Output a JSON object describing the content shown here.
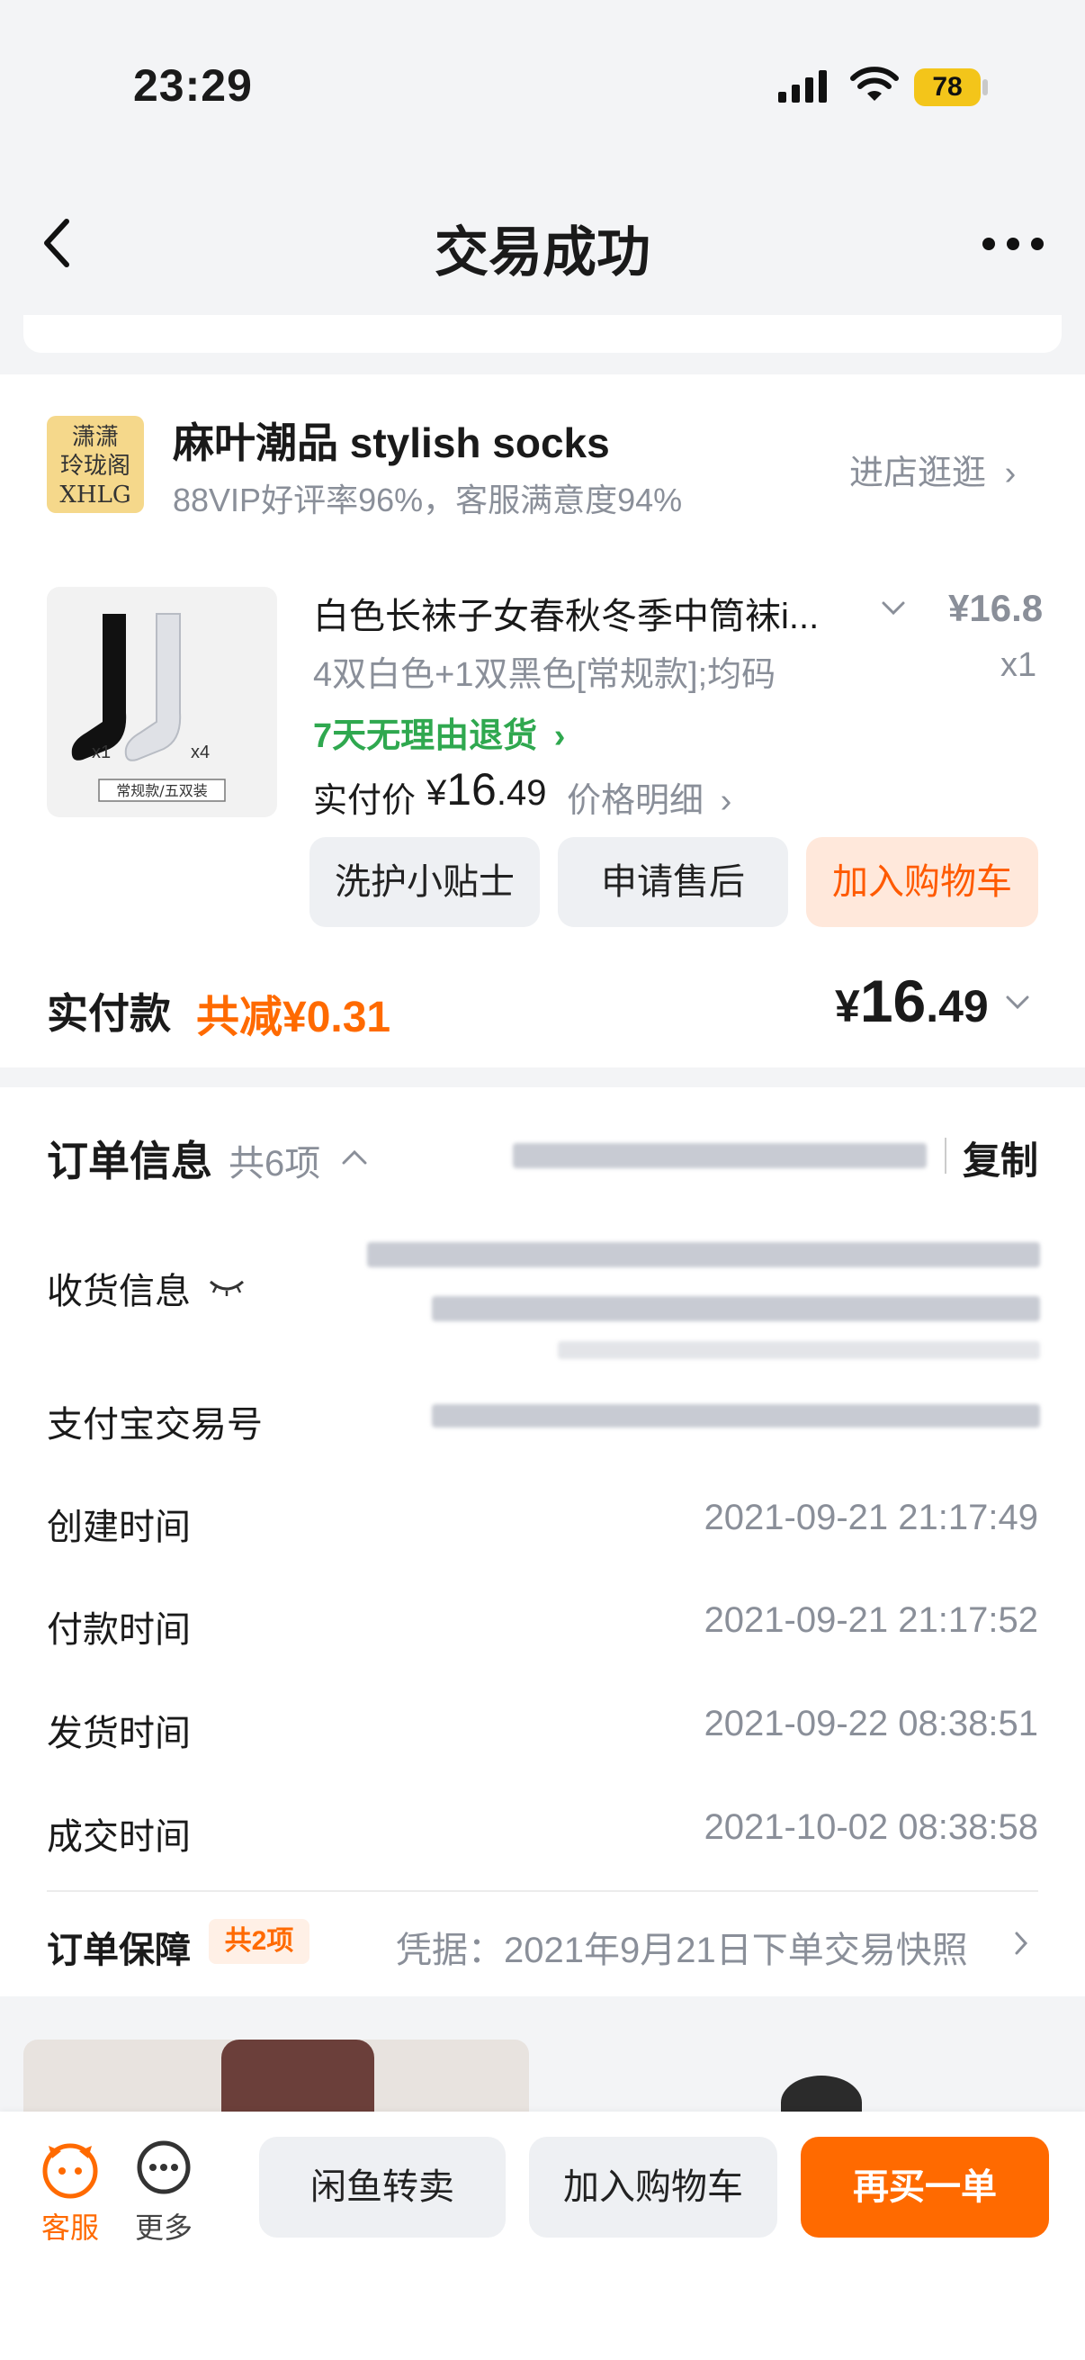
{
  "status_bar": {
    "time": "23:29",
    "battery": "78"
  },
  "nav": {
    "title": "交易成功"
  },
  "store": {
    "logo_text": "潇潇\n玲珑阁\nXHLG",
    "name": "麻叶潮品 stylish socks",
    "subtitle": "88VIP好评率96%，客服满意度94%",
    "visit_label": "进店逛逛"
  },
  "product": {
    "title": "白色长袜子女春秋冬季中筒袜i...",
    "price": "¥16.8",
    "sku": "4双白色+1双黑色[常规款];均码",
    "qty": "x1",
    "return_policy": "7天无理由退货",
    "paid_label": "实付价",
    "paid_currency": "¥",
    "paid_int": "16",
    "paid_dec": ".49",
    "price_detail": "价格明细",
    "image_tags": {
      "black_count": "x1",
      "white_count": "x4",
      "caption": "常规款/五双装"
    }
  },
  "actions": {
    "care_tips": "洗护小贴士",
    "after_sale": "申请售后",
    "add_to_cart": "加入购物车"
  },
  "total": {
    "label": "实付款",
    "discount": "共减¥0.31",
    "currency": "¥",
    "int": "16",
    "dec": ".49"
  },
  "order_info": {
    "title": "订单信息",
    "count": "共6项",
    "copy": "复制",
    "rows": [
      {
        "label": "收货信息",
        "value": ""
      },
      {
        "label": "支付宝交易号",
        "value": ""
      },
      {
        "label": "创建时间",
        "value": "2021-09-21 21:17:49"
      },
      {
        "label": "付款时间",
        "value": "2021-09-21 21:17:52"
      },
      {
        "label": "发货时间",
        "value": "2021-09-22 08:38:51"
      },
      {
        "label": "成交时间",
        "value": "2021-10-02 08:38:58"
      }
    ],
    "guarantee": {
      "label": "订单保障",
      "badge": "共2项",
      "proof": "凭据：2021年9月21日下单交易快照"
    }
  },
  "bottom_bar": {
    "customer_service": "客服",
    "more": "更多",
    "resell": "闲鱼转卖",
    "add_to_cart": "加入购物车",
    "buy_again": "再买一单"
  },
  "colors": {
    "accent": "#ff6a00",
    "green": "#2fa84f",
    "gray_text": "#8a8f99"
  }
}
